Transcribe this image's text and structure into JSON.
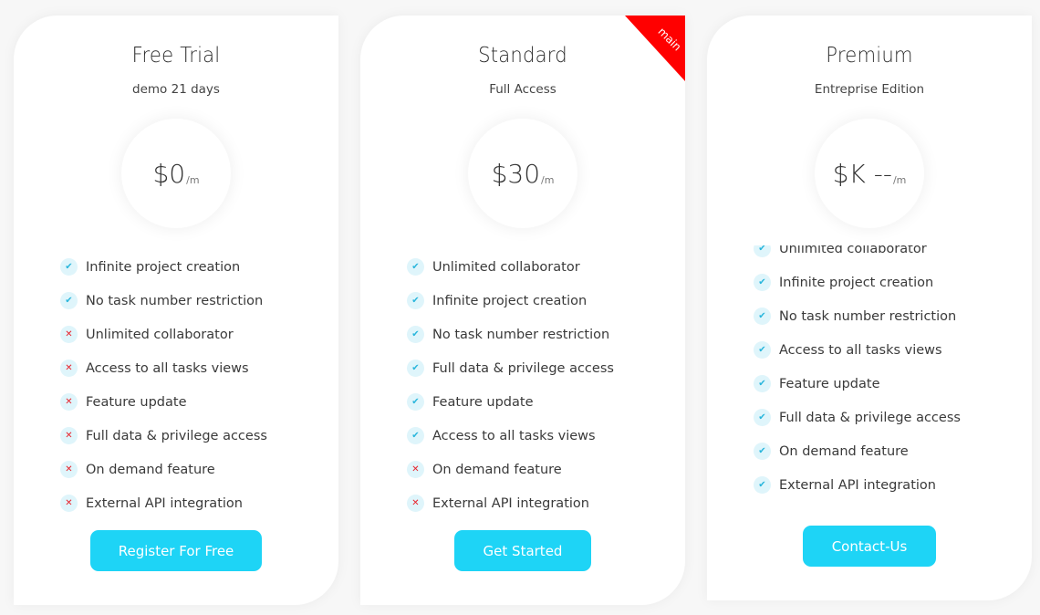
{
  "colors": {
    "accent": "#1ed4f6",
    "check": "#2ab6dc",
    "cross": "#e8232c",
    "badge_bg": "#dff5fb",
    "ribbon": "#ff0000"
  },
  "plans": [
    {
      "title": "Free Trial",
      "subtitle": "demo 21 days",
      "price": "$0",
      "period": "/m",
      "features": [
        {
          "label": "Infinite project creation",
          "included": true,
          "icon": "check-icon"
        },
        {
          "label": "No task number restriction",
          "included": true,
          "icon": "check-icon"
        },
        {
          "label": "Unlimited collaborator",
          "included": false,
          "icon": "cross-icon"
        },
        {
          "label": "Access to all tasks views",
          "included": false,
          "icon": "cross-icon"
        },
        {
          "label": "Feature update",
          "included": false,
          "icon": "cross-icon"
        },
        {
          "label": "Full data & privilege access",
          "included": false,
          "icon": "cross-icon"
        },
        {
          "label": "On demand feature",
          "included": false,
          "icon": "cross-icon"
        },
        {
          "label": "External API integration",
          "included": false,
          "icon": "cross-icon"
        }
      ],
      "cta": "Register For Free"
    },
    {
      "title": "Standard",
      "subtitle": "Full Access",
      "price": "$30",
      "period": "/m",
      "ribbon": "main",
      "features": [
        {
          "label": "Unlimited collaborator",
          "included": true,
          "icon": "check-icon"
        },
        {
          "label": "Infinite project creation",
          "included": true,
          "icon": "check-icon"
        },
        {
          "label": "No task number restriction",
          "included": true,
          "icon": "check-icon"
        },
        {
          "label": "Full data & privilege access",
          "included": true,
          "icon": "check-icon"
        },
        {
          "label": "Feature update",
          "included": true,
          "icon": "check-icon"
        },
        {
          "label": "Access to all tasks views",
          "included": true,
          "icon": "check-icon"
        },
        {
          "label": "On demand feature",
          "included": false,
          "icon": "cross-icon"
        },
        {
          "label": "External API integration",
          "included": false,
          "icon": "cross-icon"
        }
      ],
      "cta": "Get Started"
    },
    {
      "title": "Premium",
      "subtitle": "Entreprise Edition",
      "price": "$K --",
      "period": "/m",
      "features": [
        {
          "label": "Unlimited collaborator",
          "included": true,
          "icon": "check-icon"
        },
        {
          "label": "Infinite project creation",
          "included": true,
          "icon": "check-icon"
        },
        {
          "label": "No task number restriction",
          "included": true,
          "icon": "check-icon"
        },
        {
          "label": "Access to all tasks views",
          "included": true,
          "icon": "check-icon"
        },
        {
          "label": "Feature update",
          "included": true,
          "icon": "check-icon"
        },
        {
          "label": "Full data & privilege access",
          "included": true,
          "icon": "check-icon"
        },
        {
          "label": "On demand feature",
          "included": true,
          "icon": "check-icon"
        },
        {
          "label": "External API integration",
          "included": true,
          "icon": "check-icon"
        }
      ],
      "cta": "Contact-Us"
    }
  ]
}
